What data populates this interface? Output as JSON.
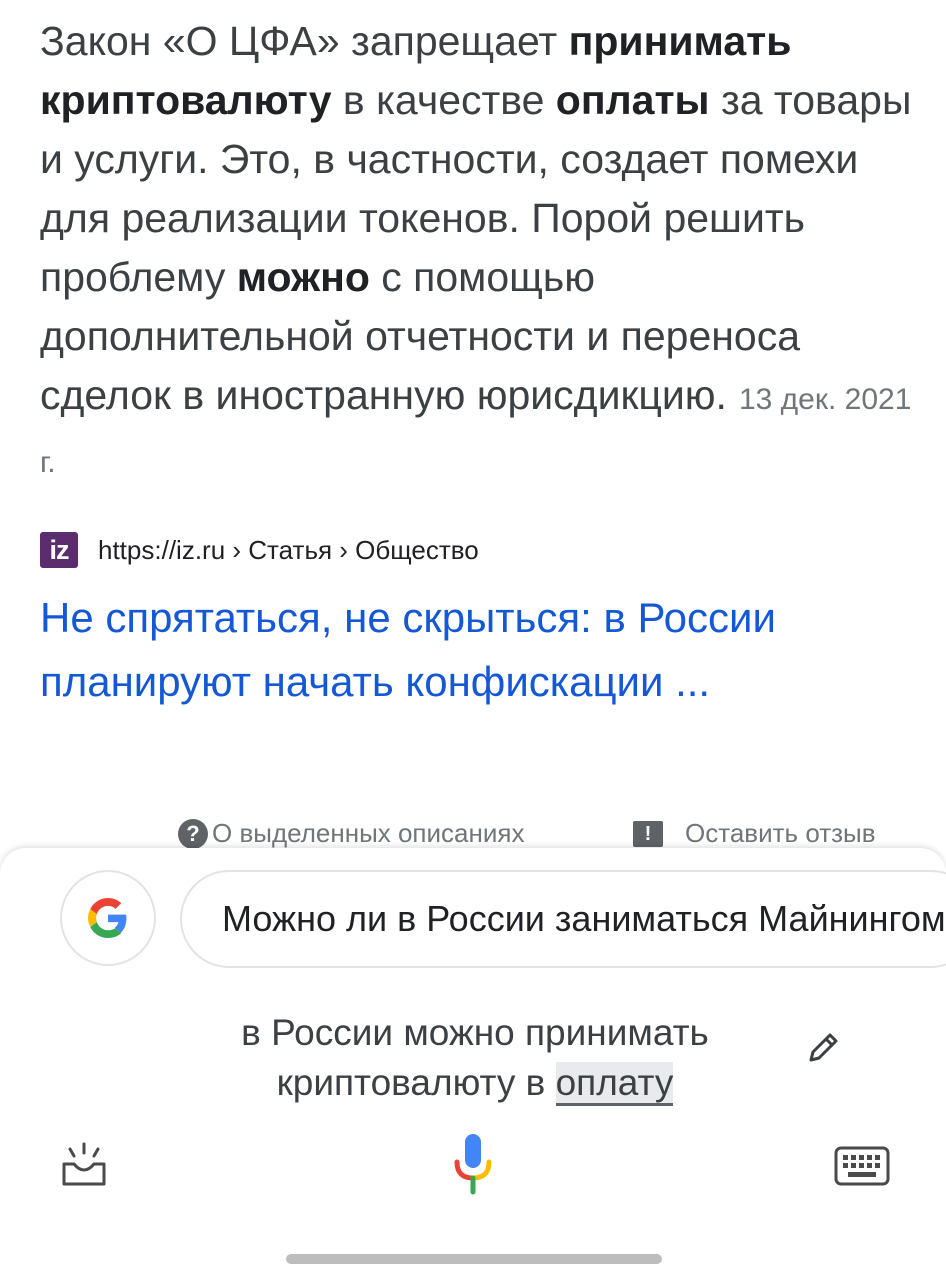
{
  "snippet": {
    "p1": "Закон «О ЦФА» запрещает ",
    "b1": "принимать криптовалюту",
    "p2": " в качестве ",
    "b2": "оплаты",
    "p3": " за товары и услуги. Это, в частности, создает помехи для реализации токенов. Порой решить проблему ",
    "b3": "можно",
    "p4": " с помощью дополнительной отчетности и переноса сделок в иностранную юрисдикцию.",
    "date": "13 дек. 2021 г."
  },
  "source": {
    "favicon_text": "iz",
    "breadcrumb": "https://iz.ru › Статья › Общество"
  },
  "result": {
    "title": "Не спрятаться, не скрыться: в России планируют начать конфискации ..."
  },
  "footer": {
    "about_icon": "?",
    "about_label": "О выделенных описаниях",
    "feedback_icon": "!",
    "feedback_label": "Оставить отзыв"
  },
  "assistant": {
    "query": "Можно ли в России заниматься Майнингом",
    "transcript_prefix": "в России можно принимать криптовалюту в ",
    "transcript_highlight": "оплату",
    "icons": [
      "google-g-icon",
      "pencil-icon",
      "lens-icon",
      "mic-icon",
      "keyboard-icon"
    ]
  },
  "colors": {
    "link_blue": "#1558d6",
    "text": "#3c4043",
    "muted": "#70757a",
    "google_blue": "#4285F4",
    "google_red": "#EA4335",
    "google_yellow": "#FBBC05",
    "google_green": "#34A853"
  }
}
